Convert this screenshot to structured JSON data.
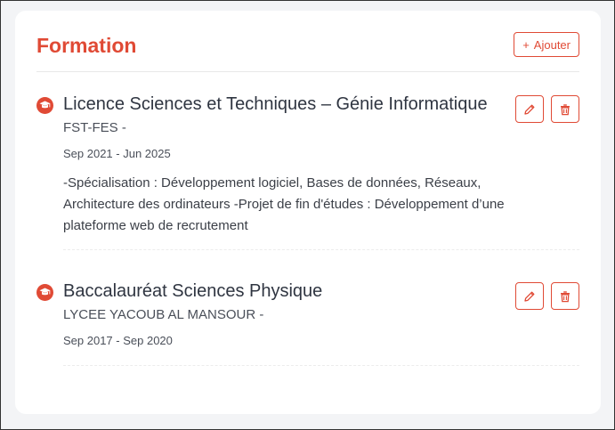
{
  "section": {
    "title": "Formation",
    "add_label": "Ajouter",
    "add_icon": "+"
  },
  "colors": {
    "accent": "#e04a35",
    "text": "#2f3541",
    "muted": "#4a4f59"
  },
  "entries": [
    {
      "icon": "graduation-cap-icon",
      "title": "Licence Sciences et Techniques – Génie Informatique",
      "school": "FST-FES -",
      "dates": "Sep 2021 - Jun 2025",
      "description": "-Spécialisation : Développement logiciel, Bases de données, Réseaux, Architecture des ordinateurs -Projet de fin d'études : Développement d’une plateforme web de recrutement"
    },
    {
      "icon": "graduation-cap-icon",
      "title": "Baccalauréat Sciences Physique",
      "school": "LYCEE YACOUB AL MANSOUR -",
      "dates": "Sep 2017 - Sep 2020",
      "description": ""
    }
  ]
}
